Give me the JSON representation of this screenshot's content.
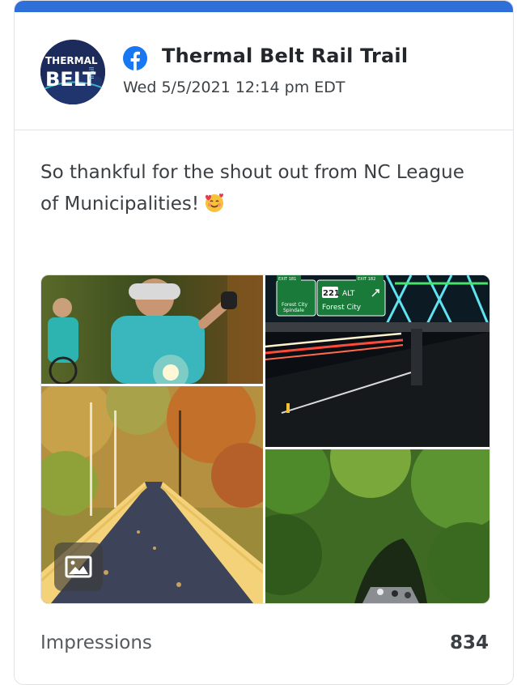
{
  "post": {
    "account_name": "Thermal Belt Rail Trail",
    "timestamp": "Wed 5/5/2021 12:14 pm EDT",
    "platform_icon": "facebook-icon",
    "message": "So thankful for the shout out from NC League of Municipalities!",
    "emoji": "smiling-face-with-hearts-emoji",
    "avatar_text_line1": "THERMAL",
    "avatar_text_line2": "BELT",
    "avatar_text_side": "Trail"
  },
  "gallery": {
    "media_type_icon": "image-icon",
    "photos": [
      {
        "id": "cyclists"
      },
      {
        "id": "highway-bridge-night",
        "sign_left_line1": "Forest City",
        "sign_left_line2": "Spindale",
        "sign_route": "221",
        "sign_route_suffix": "ALT",
        "sign_right": "Forest City",
        "exit_left": "EXIT 181",
        "exit_right": "EXIT 182"
      },
      {
        "id": "autumn-bridge"
      },
      {
        "id": "green-tunnel"
      }
    ]
  },
  "stats": {
    "label": "Impressions",
    "value": "834"
  },
  "colors": {
    "accent": "#2f6fd8",
    "facebook": "#1877f2"
  }
}
